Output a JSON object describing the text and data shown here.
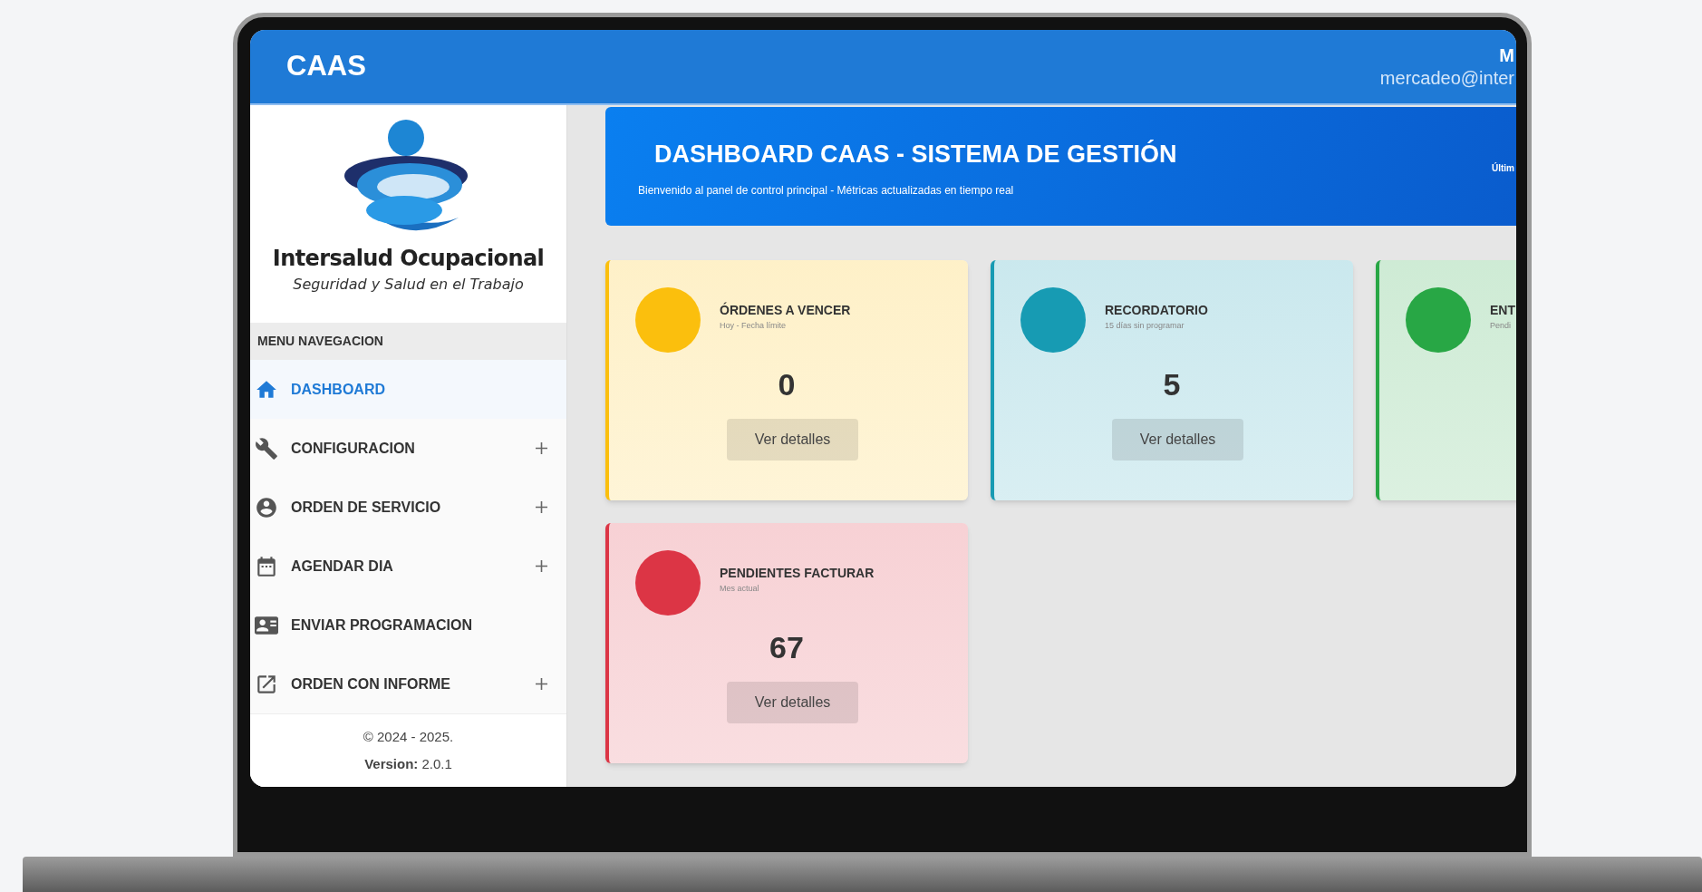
{
  "header": {
    "title": "CAAS",
    "user_name": "M",
    "user_email": "mercadeo@inter"
  },
  "sidebar": {
    "brand": "Intersalud Ocupacional",
    "tagline": "Seguridad y Salud en el Trabajo",
    "menu_heading": "MENU NAVEGACION",
    "items": [
      {
        "label": "DASHBOARD",
        "selected": true,
        "expandable": false
      },
      {
        "label": "CONFIGURACION",
        "selected": false,
        "expandable": true
      },
      {
        "label": "ORDEN DE SERVICIO",
        "selected": false,
        "expandable": true
      },
      {
        "label": "AGENDAR DIA",
        "selected": false,
        "expandable": true
      },
      {
        "label": "ENVIAR PROGRAMACION",
        "selected": false,
        "expandable": false
      },
      {
        "label": "ORDEN CON INFORME",
        "selected": false,
        "expandable": true
      }
    ],
    "copyright": "© 2024 - 2025.",
    "version_label": "Version:",
    "version": "2.0.1"
  },
  "banner": {
    "title": "DASHBOARD CAAS - SISTEMA DE GESTIÓN",
    "subtitle": "Bienvenido al panel de control principal - Métricas actualizadas en tiempo real",
    "side_text": "Últim"
  },
  "cards": [
    {
      "title": "ÓRDENES A VENCER",
      "subtitle": "Hoy - Fecha límite",
      "value": "0",
      "button": "Ver detalles",
      "color": "#fbbf0d"
    },
    {
      "title": "RECORDATORIO",
      "subtitle": "15 días sin programar",
      "value": "5",
      "button": "Ver detalles",
      "color": "#179bb3"
    },
    {
      "title": "ENT",
      "subtitle": "Pendi",
      "color": "#28a745"
    },
    {
      "title": "PENDIENTES FACTURAR",
      "subtitle": "Mes actual",
      "value": "67",
      "button": "Ver detalles",
      "color": "#dc3545"
    }
  ]
}
